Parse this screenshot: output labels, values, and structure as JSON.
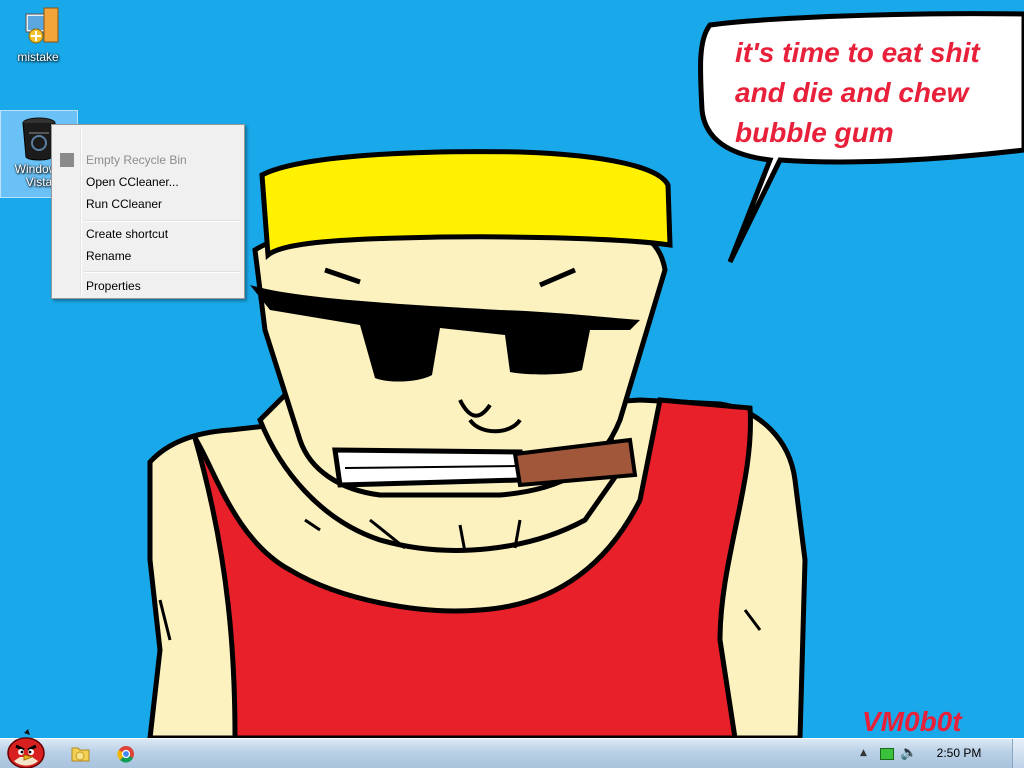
{
  "desktop": {
    "icons": [
      {
        "label": "mistake"
      },
      {
        "label_line1": "Windows",
        "label_line2": "Vista"
      }
    ],
    "wallpaper": {
      "speech_line1": "it's time to eat shit",
      "speech_line2": "and die and chew",
      "speech_line3": "bubble gum",
      "signature": "VM0b0t"
    }
  },
  "context_menu": {
    "items": [
      {
        "label": "Empty Recycle Bin",
        "enabled": false
      },
      {
        "label": "Open CCleaner..."
      },
      {
        "label": "Run CCleaner"
      },
      {
        "label": "Create shortcut"
      },
      {
        "label": "Rename"
      },
      {
        "label": "Properties"
      }
    ]
  },
  "taskbar": {
    "clock": "2:50 PM",
    "pinned": [
      "start-orb-angry-bird-icon",
      "file-explorer-icon",
      "chrome-icon"
    ]
  },
  "colors": {
    "sky": "#19a9ea",
    "shirt": "#e8202a",
    "skin": "#fbf2c0",
    "hat": "#fff100",
    "speech_text": "#e8203a"
  }
}
